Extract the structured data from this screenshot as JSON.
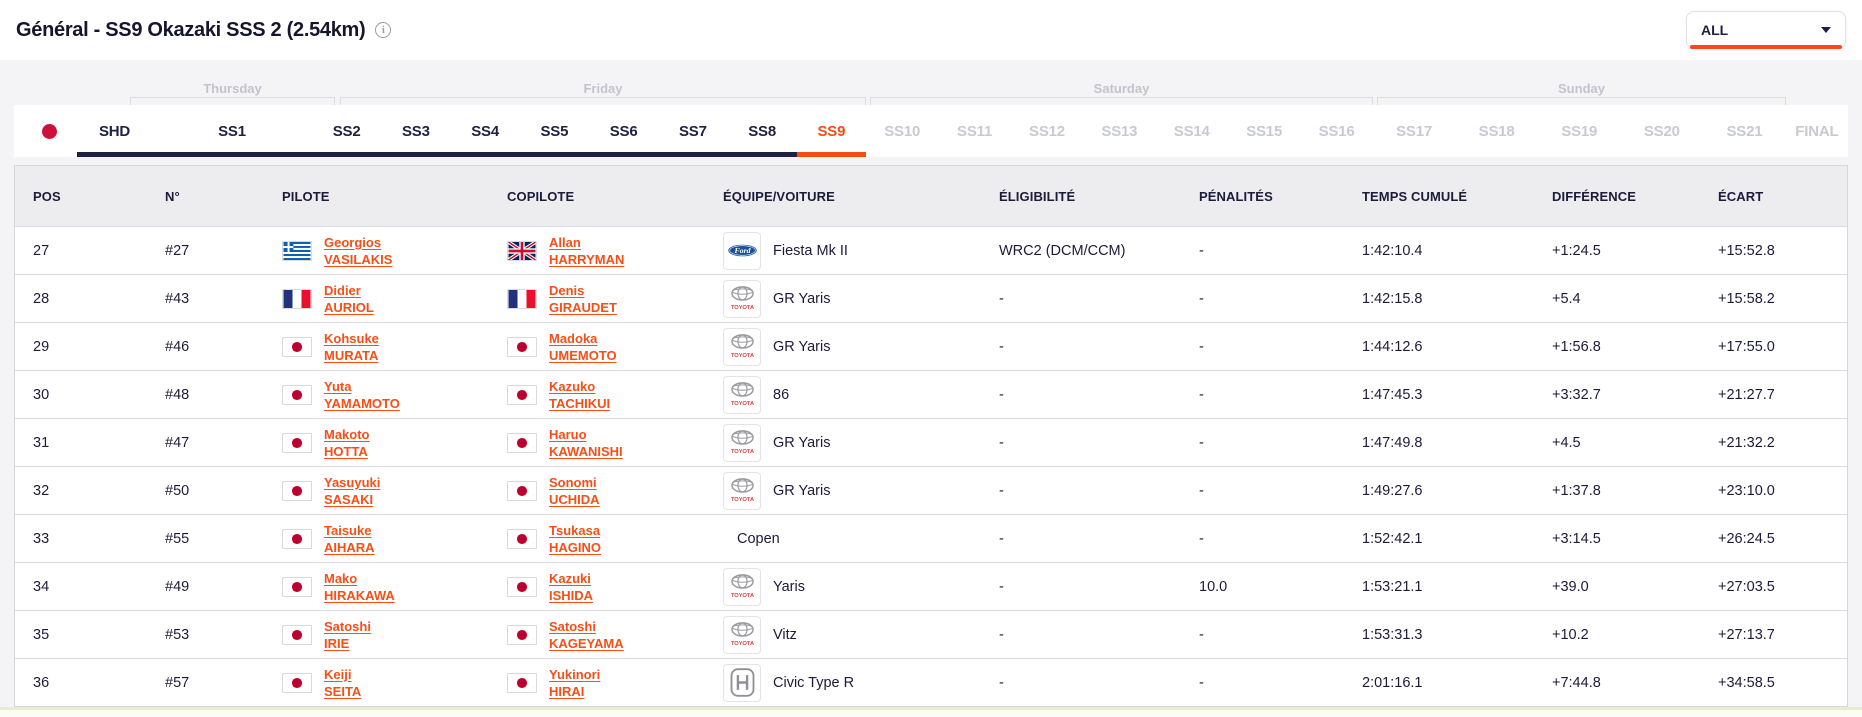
{
  "header": {
    "title": "Général - SS9 Okazaki SSS 2 (2.54km)",
    "info_icon": "i",
    "filter": {
      "value": "ALL"
    }
  },
  "stage_nav": {
    "days": [
      {
        "label": "Thursday"
      },
      {
        "label": "Friday"
      },
      {
        "label": "Saturday"
      },
      {
        "label": "Sunday"
      }
    ],
    "stages": [
      {
        "label": "SHD",
        "state": "completed",
        "group": "shd"
      },
      {
        "label": "SS1",
        "state": "completed",
        "group": "thu"
      },
      {
        "label": "SS2",
        "state": "completed",
        "group": "fri"
      },
      {
        "label": "SS3",
        "state": "completed",
        "group": "fri"
      },
      {
        "label": "SS4",
        "state": "completed",
        "group": "fri"
      },
      {
        "label": "SS5",
        "state": "completed",
        "group": "fri"
      },
      {
        "label": "SS6",
        "state": "completed",
        "group": "fri"
      },
      {
        "label": "SS7",
        "state": "completed",
        "group": "fri"
      },
      {
        "label": "SS8",
        "state": "completed",
        "group": "fri"
      },
      {
        "label": "SS9",
        "state": "active",
        "group": "fri"
      },
      {
        "label": "SS10",
        "state": "upcoming",
        "group": "sat"
      },
      {
        "label": "SS11",
        "state": "upcoming",
        "group": "sat"
      },
      {
        "label": "SS12",
        "state": "upcoming",
        "group": "sat"
      },
      {
        "label": "SS13",
        "state": "upcoming",
        "group": "sat"
      },
      {
        "label": "SS14",
        "state": "upcoming",
        "group": "sat"
      },
      {
        "label": "SS15",
        "state": "upcoming",
        "group": "sat"
      },
      {
        "label": "SS16",
        "state": "upcoming",
        "group": "sat"
      },
      {
        "label": "SS17",
        "state": "upcoming",
        "group": "sun"
      },
      {
        "label": "SS18",
        "state": "upcoming",
        "group": "sun"
      },
      {
        "label": "SS19",
        "state": "upcoming",
        "group": "sun"
      },
      {
        "label": "SS20",
        "state": "upcoming",
        "group": "sun"
      },
      {
        "label": "SS21",
        "state": "upcoming",
        "group": "sun"
      },
      {
        "label": "FINAL",
        "state": "upcoming",
        "group": "final"
      }
    ]
  },
  "table": {
    "columns": [
      "POS",
      "N°",
      "PILOTE",
      "COPILOTE",
      "ÉQUIPE/VOITURE",
      "ÉLIGIBILITÉ",
      "PÉNALITÉS",
      "TEMPS CUMULÉ",
      "DIFFÉRENCE",
      "ÉCART"
    ],
    "rows": [
      {
        "pos": "27",
        "num": "#27",
        "pilot": {
          "first": "Georgios",
          "last": "VASILAKIS",
          "flag": "gr"
        },
        "copilot": {
          "first": "Allan",
          "last": "HARRYMAN",
          "flag": "gb"
        },
        "car": {
          "make": "ford",
          "model": "Fiesta Mk II"
        },
        "eligibility": "WRC2 (DCM/CCM)",
        "penalties": "-",
        "time": "1:42:10.4",
        "difference": "+1:24.5",
        "gap": "+15:52.8"
      },
      {
        "pos": "28",
        "num": "#43",
        "pilot": {
          "first": "Didier",
          "last": "AURIOL",
          "flag": "fr"
        },
        "copilot": {
          "first": "Denis",
          "last": "GIRAUDET",
          "flag": "fr"
        },
        "car": {
          "make": "toyota",
          "model": "GR Yaris"
        },
        "eligibility": "-",
        "penalties": "-",
        "time": "1:42:15.8",
        "difference": "+5.4",
        "gap": "+15:58.2"
      },
      {
        "pos": "29",
        "num": "#46",
        "pilot": {
          "first": "Kohsuke",
          "last": "MURATA",
          "flag": "jp"
        },
        "copilot": {
          "first": "Madoka",
          "last": "UMEMOTO",
          "flag": "jp"
        },
        "car": {
          "make": "toyota",
          "model": "GR Yaris"
        },
        "eligibility": "-",
        "penalties": "-",
        "time": "1:44:12.6",
        "difference": "+1:56.8",
        "gap": "+17:55.0"
      },
      {
        "pos": "30",
        "num": "#48",
        "pilot": {
          "first": "Yuta",
          "last": "YAMAMOTO",
          "flag": "jp"
        },
        "copilot": {
          "first": "Kazuko",
          "last": "TACHIKUI",
          "flag": "jp"
        },
        "car": {
          "make": "toyota",
          "model": "86"
        },
        "eligibility": "-",
        "penalties": "-",
        "time": "1:47:45.3",
        "difference": "+3:32.7",
        "gap": "+21:27.7"
      },
      {
        "pos": "31",
        "num": "#47",
        "pilot": {
          "first": "Makoto",
          "last": "HOTTA",
          "flag": "jp"
        },
        "copilot": {
          "first": "Haruo",
          "last": "KAWANISHI",
          "flag": "jp"
        },
        "car": {
          "make": "toyota",
          "model": "GR Yaris"
        },
        "eligibility": "-",
        "penalties": "-",
        "time": "1:47:49.8",
        "difference": "+4.5",
        "gap": "+21:32.2"
      },
      {
        "pos": "32",
        "num": "#50",
        "pilot": {
          "first": "Yasuyuki",
          "last": "SASAKI",
          "flag": "jp"
        },
        "copilot": {
          "first": "Sonomi",
          "last": "UCHIDA",
          "flag": "jp"
        },
        "car": {
          "make": "toyota",
          "model": "GR Yaris"
        },
        "eligibility": "-",
        "penalties": "-",
        "time": "1:49:27.6",
        "difference": "+1:37.8",
        "gap": "+23:10.0"
      },
      {
        "pos": "33",
        "num": "#55",
        "pilot": {
          "first": "Taisuke",
          "last": "AIHARA",
          "flag": "jp"
        },
        "copilot": {
          "first": "Tsukasa",
          "last": "HAGINO",
          "flag": "jp"
        },
        "car": {
          "make": "none",
          "model": "Copen"
        },
        "eligibility": "-",
        "penalties": "-",
        "time": "1:52:42.1",
        "difference": "+3:14.5",
        "gap": "+26:24.5"
      },
      {
        "pos": "34",
        "num": "#49",
        "pilot": {
          "first": "Mako",
          "last": "HIRAKAWA",
          "flag": "jp"
        },
        "copilot": {
          "first": "Kazuki",
          "last": "ISHIDA",
          "flag": "jp"
        },
        "car": {
          "make": "toyota",
          "model": "Yaris"
        },
        "eligibility": "-",
        "penalties": "10.0",
        "time": "1:53:21.1",
        "difference": "+39.0",
        "gap": "+27:03.5"
      },
      {
        "pos": "35",
        "num": "#53",
        "pilot": {
          "first": "Satoshi",
          "last": "IRIE",
          "flag": "jp"
        },
        "copilot": {
          "first": "Satoshi",
          "last": "KAGEYAMA",
          "flag": "jp"
        },
        "car": {
          "make": "toyota",
          "model": "Vitz"
        },
        "eligibility": "-",
        "penalties": "-",
        "time": "1:53:31.3",
        "difference": "+10.2",
        "gap": "+27:13.7"
      },
      {
        "pos": "36",
        "num": "#57",
        "pilot": {
          "first": "Keiji",
          "last": "SEITA",
          "flag": "jp"
        },
        "copilot": {
          "first": "Yukinori",
          "last": "HIRAI",
          "flag": "jp"
        },
        "car": {
          "make": "honda",
          "model": "Civic Type R"
        },
        "eligibility": "-",
        "penalties": "-",
        "time": "2:01:16.1",
        "difference": "+7:44.8",
        "gap": "+34:58.5"
      }
    ]
  },
  "colors": {
    "accent_orange": "#f84b14",
    "navy": "#1e2142",
    "inactive_gray": "#c9c9d3",
    "live_dot_red": "#d0103c",
    "japan_flag_red": "#bc002d"
  }
}
